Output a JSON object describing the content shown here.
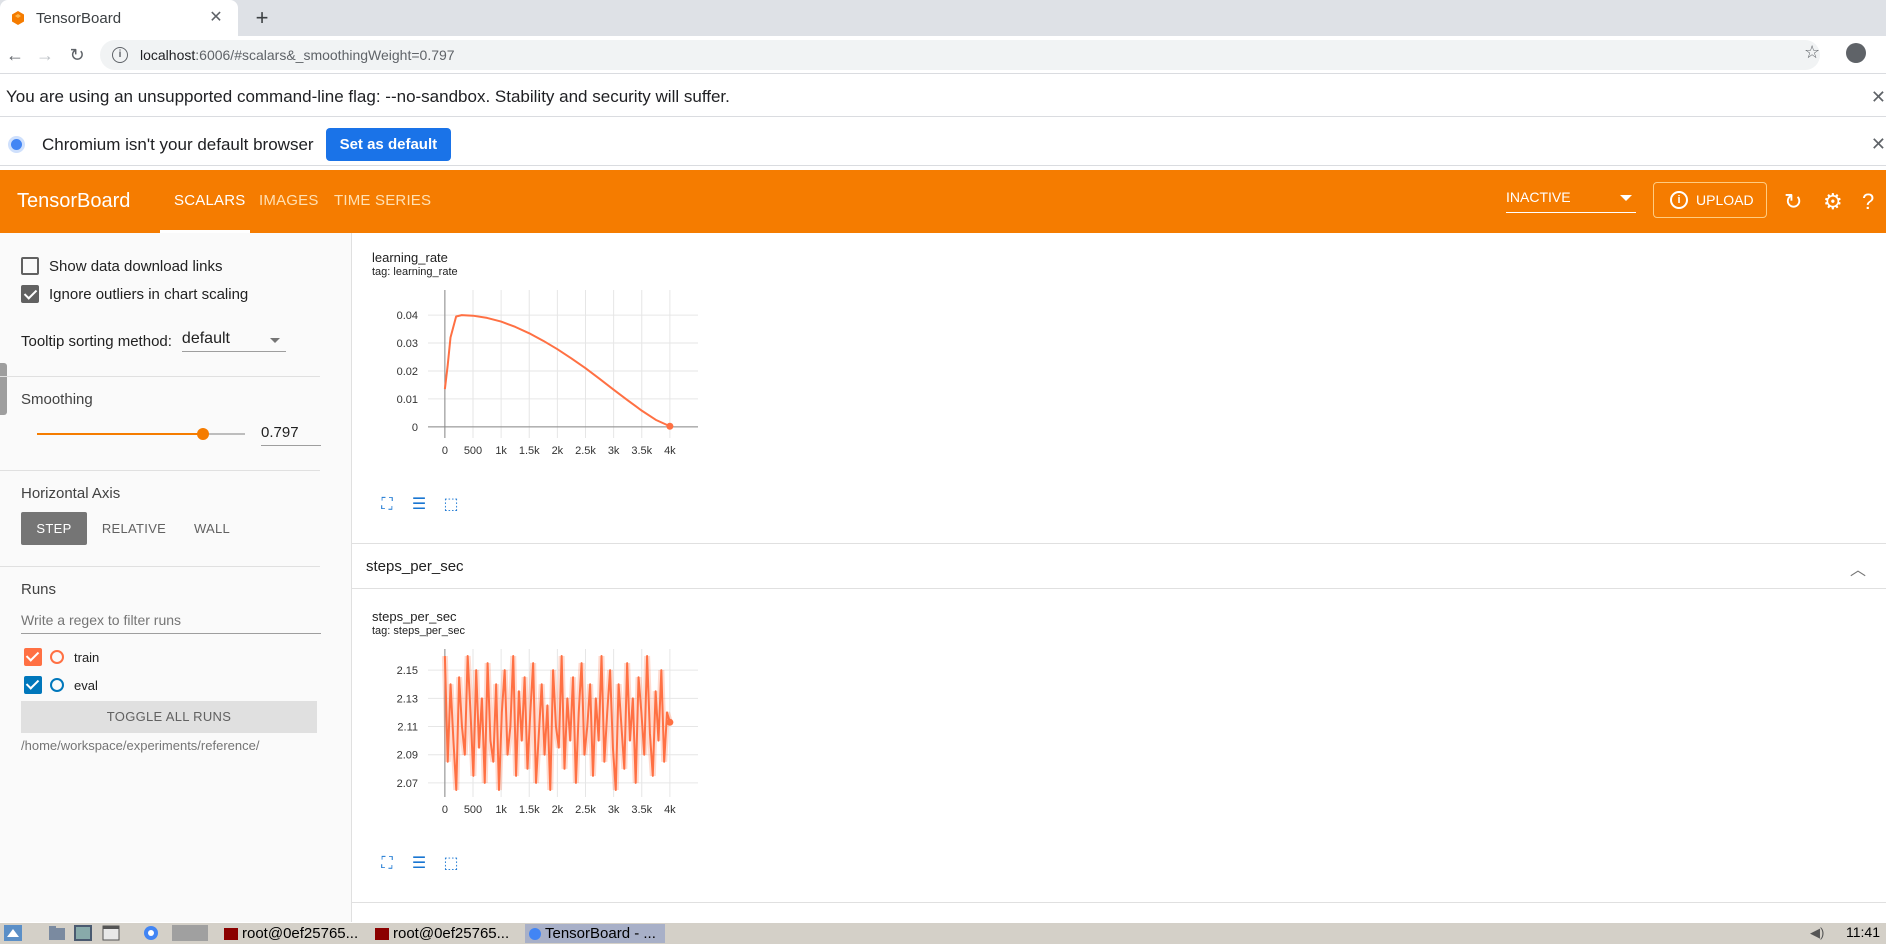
{
  "browser": {
    "tab_title": "TensorBoard",
    "url_host": "localhost",
    "url_rest": ":6006/#scalars&_smoothingWeight=0.797"
  },
  "infobars": {
    "sandbox_warning": "You are using an unsupported command-line flag: --no-sandbox. Stability and security will suffer.",
    "default_browser": "Chromium isn't your default browser",
    "set_default_label": "Set as default"
  },
  "header": {
    "brand": "TensorBoard",
    "tabs": [
      {
        "label": "SCALARS",
        "active": true
      },
      {
        "label": "IMAGES",
        "active": false
      },
      {
        "label": "TIME SERIES",
        "active": false
      }
    ],
    "run_status": "INACTIVE",
    "upload_label": "UPLOAD",
    "accent": "#f57c00"
  },
  "sidebar": {
    "show_download_links": "Show data download links",
    "ignore_outliers": "Ignore outliers in chart scaling",
    "tooltip_sorting_label": "Tooltip sorting method:",
    "tooltip_sorting_value": "default",
    "smoothing_label": "Smoothing",
    "smoothing_value": "0.797",
    "smoothing_fraction": 0.797,
    "horizontal_axis_label": "Horizontal Axis",
    "axis_options": [
      "STEP",
      "RELATIVE",
      "WALL"
    ],
    "axis_selected": "STEP",
    "runs_label": "Runs",
    "regex_placeholder": "Write a regex to filter runs",
    "runs": [
      {
        "name": "train",
        "color": "#ff7043",
        "checked": true
      },
      {
        "name": "eval",
        "color": "#0077bb",
        "checked": true
      }
    ],
    "toggle_all_label": "TOGGLE ALL RUNS",
    "logdir": "/home/workspace/experiments/reference/"
  },
  "main": {
    "group_name": "steps_per_sec"
  },
  "charts": [
    {
      "title": "learning_rate",
      "tag": "tag: learning_rate",
      "chart_data": {
        "type": "line",
        "x": [
          0,
          50,
          100,
          200,
          300,
          500,
          750,
          1000,
          1250,
          1500,
          1750,
          2000,
          2250,
          2500,
          2750,
          3000,
          3250,
          3500,
          3750,
          4000
        ],
        "series": [
          {
            "values": [
              0.0135,
              0.022,
              0.032,
              0.0395,
              0.04,
              0.0398,
              0.039,
              0.0377,
              0.0358,
              0.0335,
              0.0308,
              0.0278,
              0.0245,
              0.021,
              0.0172,
              0.0133,
              0.0095,
              0.0058,
              0.0025,
              0.0002
            ],
            "color": "#ff7043"
          }
        ],
        "x_ticks": [
          "0",
          "500",
          "1k",
          "1.5k",
          "2k",
          "2.5k",
          "3k",
          "3.5k",
          "4k"
        ],
        "y_ticks": [
          "0.04",
          "0.03",
          "0.02",
          "0.01",
          "0"
        ],
        "xlim": [
          -300,
          4500
        ],
        "ylim": [
          -0.004,
          0.049
        ]
      }
    },
    {
      "title": "steps_per_sec",
      "tag": "tag: steps_per_sec",
      "chart_data": {
        "type": "line",
        "x_ticks": [
          "0",
          "500",
          "1k",
          "1.5k",
          "2k",
          "2.5k",
          "3k",
          "3.5k",
          "4k"
        ],
        "y_ticks": [
          "2.15",
          "2.13",
          "2.11",
          "2.09",
          "2.07"
        ],
        "xlim": [
          -300,
          4500
        ],
        "ylim": [
          2.06,
          2.165
        ],
        "series": [
          {
            "values": [
              2.16,
              2.085,
              2.14,
              2.1,
              2.065,
              2.145,
              2.11,
              2.09,
              2.16,
              2.12,
              2.075,
              2.15,
              2.095,
              2.13,
              2.07,
              2.155,
              2.1,
              2.085,
              2.14,
              2.065,
              2.12,
              2.15,
              2.09,
              2.11,
              2.16,
              2.075,
              2.135,
              2.1,
              2.145,
              2.08,
              2.12,
              2.155,
              2.07,
              2.105,
              2.14,
              2.09,
              2.125,
              2.065,
              2.15,
              2.11,
              2.095,
              2.16,
              2.08,
              2.13,
              2.1,
              2.145,
              2.07,
              2.12,
              2.155,
              2.09,
              2.11,
              2.14,
              2.075,
              2.13,
              2.1,
              2.16,
              2.085,
              2.12,
              2.15,
              2.095,
              2.065,
              2.14,
              2.11,
              2.08,
              2.155,
              2.1,
              2.13,
              2.07,
              2.145,
              2.12,
              2.09,
              2.16,
              2.105,
              2.075,
              2.135,
              2.1,
              2.15,
              2.085,
              2.12,
              2.113
            ],
            "x_start": 0,
            "x_end": 4000,
            "color": "#ff7043"
          }
        ]
      }
    }
  ],
  "taskbar": {
    "tasks": [
      "root@0ef25765...",
      "root@0ef25765...",
      "TensorBoard - ..."
    ],
    "clock": "11:41"
  }
}
